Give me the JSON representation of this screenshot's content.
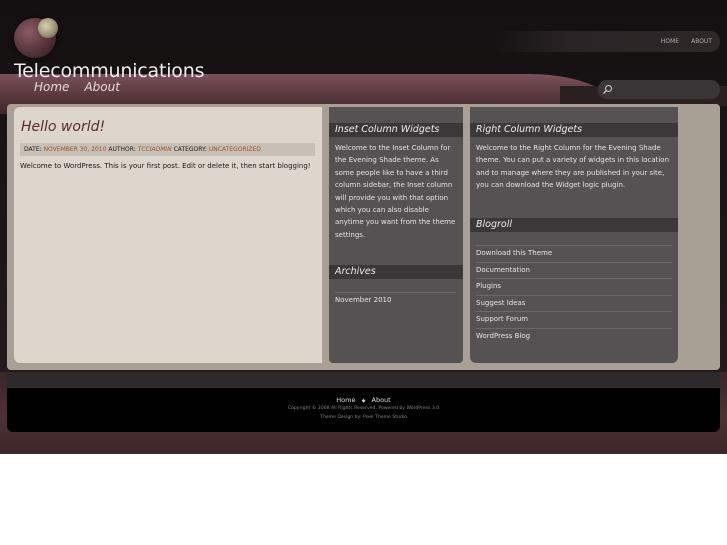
{
  "site": {
    "title": "Telecommunications"
  },
  "main_nav": [
    "Home",
    "About"
  ],
  "top_nav": [
    "HOME",
    "ABOUT"
  ],
  "search": {
    "placeholder": ""
  },
  "post": {
    "title": "Hello world!",
    "meta": {
      "date_label": "DATE:",
      "date": "NOVEMBER 30, 2010",
      "author_label": "AUTHOR:",
      "author": "TCCIADMIN",
      "category_label": "CATEGORY:",
      "category": "UNCATEGORIZED"
    },
    "body": "Welcome to WordPress. This is your first post. Edit or delete it, then start blogging!"
  },
  "inset_column": {
    "title": "Inset Column Widgets",
    "lines": [
      "Welcome to the Inset Column for",
      "the Evening Shade theme. As",
      "some people like to have a third",
      "column sidebar, the Inset column",
      "will provide you with that option",
      "which you can also disable",
      "anytime you want from the theme",
      "settings."
    ],
    "archives_title": "Archives",
    "archives": [
      "November 2010"
    ]
  },
  "right_column": {
    "title": "Right Column Widgets",
    "lines": [
      "Welcome to the Right Column for the Evening Shade",
      "theme. You can put a variety of widgets in this location",
      "and to manage where they are published in your site,",
      "you can download the Widget logic plugin."
    ],
    "blogroll_title": "Blogroll",
    "blogroll": [
      "Download this Theme",
      "Documentation",
      "Plugins",
      "Suggest Ideas",
      "Support Forum",
      "WordPress Blog"
    ]
  },
  "footer": {
    "nav": [
      "Home",
      "About"
    ],
    "copyright": "Copyright © 2008 All Rights Reserved. Powered by WordPress 3.0",
    "credits": "Theme Design by: Pixel Theme Studio"
  },
  "colors": {
    "accent": "#a0522d",
    "post_bg": "#dcd6cc",
    "sidebar_bg": "#545252"
  },
  "icons": {
    "search": "magnifier-icon"
  }
}
